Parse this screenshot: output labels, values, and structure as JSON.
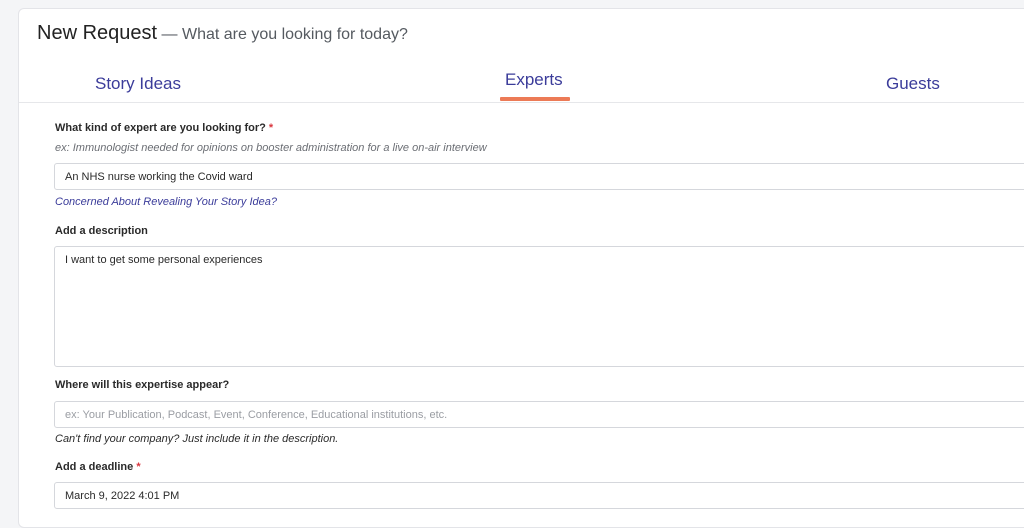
{
  "header": {
    "title": "New Request",
    "subtitle": "— What are you looking for today?"
  },
  "tabs": [
    {
      "label": "Story Ideas",
      "active": false
    },
    {
      "label": "Experts",
      "active": true
    },
    {
      "label": "Guests",
      "active": false
    }
  ],
  "colors": {
    "accent": "#3b3c9a",
    "active_underline": "#ec7a56",
    "required": "#d9363e"
  },
  "form": {
    "expert": {
      "label": "What kind of expert are you looking for?",
      "required_mark": "*",
      "hint": "ex: Immunologist needed for opinions on booster administration for a live on-air interview",
      "value": "An NHS nurse working the Covid ward",
      "link": "Concerned About Revealing Your Story Idea?"
    },
    "description": {
      "label": "Add a description",
      "value": "I want to get some personal experiences"
    },
    "appearance": {
      "label": "Where will this expertise appear?",
      "placeholder": "ex: Your Publication, Podcast, Event, Conference, Educational institutions, etc.",
      "value": "",
      "note": "Can't find your company? Just include it in the description."
    },
    "deadline": {
      "label": "Add a deadline",
      "required_mark": "*",
      "value": "March 9, 2022 4:01 PM"
    }
  }
}
